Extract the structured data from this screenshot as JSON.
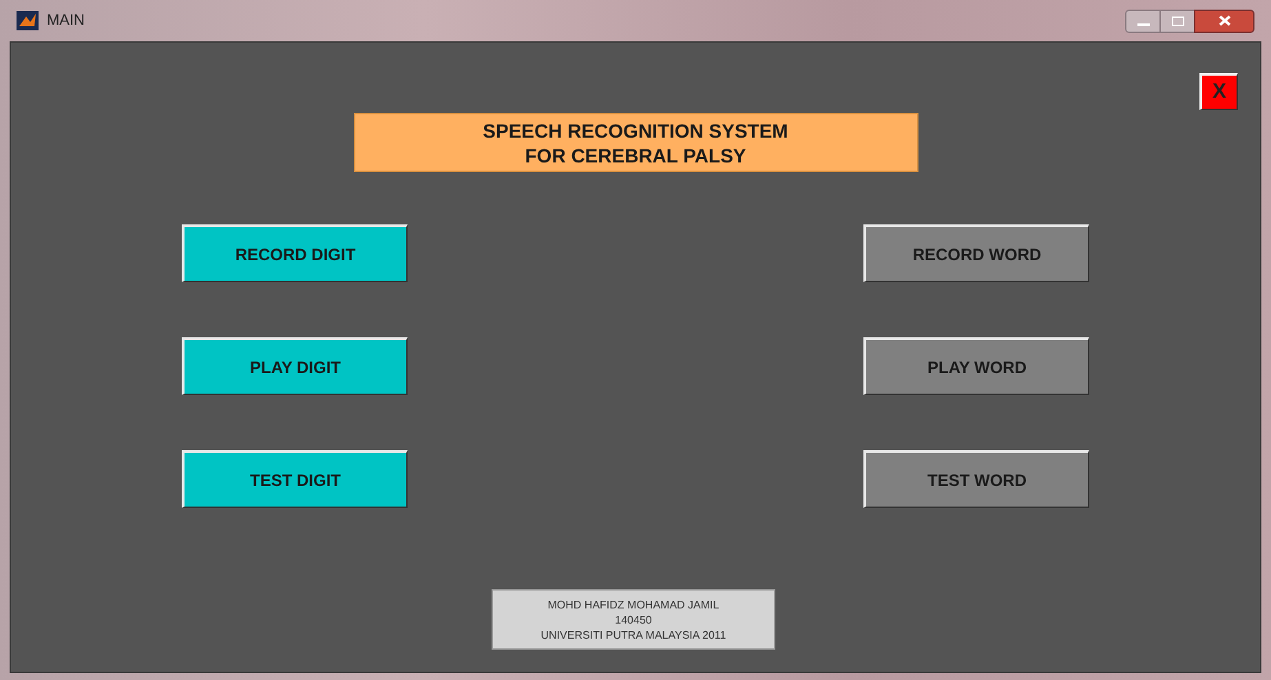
{
  "window": {
    "title": "MAIN"
  },
  "close_button": {
    "label": "X"
  },
  "header": {
    "lines": [
      "SPEECH RECOGNITION SYSTEM",
      "FOR CEREBRAL PALSY"
    ]
  },
  "left_buttons": [
    {
      "label": "RECORD DIGIT",
      "color": "#00c4c4"
    },
    {
      "label": "PLAY DIGIT",
      "color": "#00c4c4"
    },
    {
      "label": "TEST DIGIT",
      "color": "#00c4c4"
    }
  ],
  "right_buttons": [
    {
      "label": "RECORD WORD",
      "color": "#808080"
    },
    {
      "label": "PLAY WORD",
      "color": "#808080"
    },
    {
      "label": "TEST WORD",
      "color": "#808080"
    }
  ],
  "footer": {
    "lines": [
      "MOHD HAFIDZ MOHAMAD JAMIL",
      "140450",
      "UNIVERSITI PUTRA MALAYSIA 2011"
    ]
  }
}
